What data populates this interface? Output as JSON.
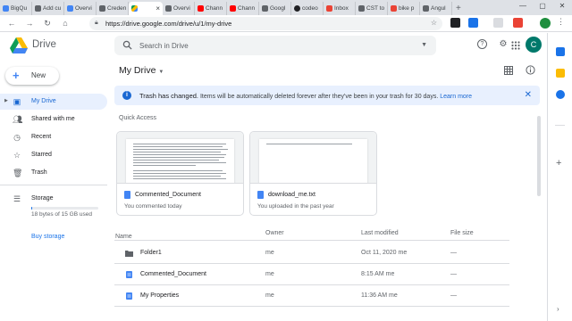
{
  "browser": {
    "tabs": [
      {
        "label": "BigQu",
        "color": "#4285f4"
      },
      {
        "label": "Add cu",
        "color": "#5f6368"
      },
      {
        "label": "Overvi",
        "color": "#4285f4"
      },
      {
        "label": "Creden",
        "color": "#5f6368"
      },
      {
        "label": "",
        "color": "#0f9d58",
        "active": true
      },
      {
        "label": "Overvi",
        "color": "#5f6368"
      },
      {
        "label": "Chann",
        "color": "#ff0000"
      },
      {
        "label": "Chann",
        "color": "#ff0000"
      },
      {
        "label": "Googl",
        "color": "#5f6368"
      },
      {
        "label": "codeo",
        "color": "#202124"
      },
      {
        "label": "Inbox",
        "color": "#ea4335"
      },
      {
        "label": "CST to",
        "color": "#5f6368"
      },
      {
        "label": "bike p",
        "color": "#ea4335"
      },
      {
        "label": "Angul",
        "color": "#5f6368"
      }
    ],
    "active_close": "×",
    "new_tab": "+",
    "url": "https://drive.google.com/drive/u/1/my-drive",
    "window_controls": [
      "—",
      "▢",
      "✕"
    ]
  },
  "header": {
    "app_name": "Drive",
    "search_placeholder": "Search in Drive",
    "profile_initial": "C"
  },
  "sidebar": {
    "new_label": "New",
    "items": [
      {
        "label": "My Drive",
        "icon": "drive-icon",
        "active": true
      },
      {
        "label": "Shared with me",
        "icon": "people-icon"
      },
      {
        "label": "Recent",
        "icon": "clock-icon"
      },
      {
        "label": "Starred",
        "icon": "star-icon"
      },
      {
        "label": "Trash",
        "icon": "trash-icon"
      }
    ],
    "storage_label": "Storage",
    "storage_used": "18 bytes of 15 GB used",
    "storage_fraction": 1.2e-09,
    "buy_storage": "Buy storage"
  },
  "main": {
    "title": "My Drive",
    "banner": {
      "bold": "Trash has changed.",
      "text": " Items will be automatically deleted forever after they've been in your trash for 30 days. ",
      "link": "Learn more"
    },
    "quick_access_label": "Quick Access",
    "cards": [
      {
        "name": "Commented_Document",
        "sub": "You commented today"
      },
      {
        "name": "download_me.txt",
        "sub": "You uploaded in the past year"
      }
    ],
    "columns": {
      "name": "Name",
      "owner": "Owner",
      "modified": "Last modified",
      "size": "File size"
    },
    "rows": [
      {
        "name": "Folder1",
        "owner": "me",
        "modified": "Oct 11, 2020 me",
        "size": "—",
        "type": "folder"
      },
      {
        "name": "Commented_Document",
        "owner": "me",
        "modified": "8:15 AM me",
        "size": "—",
        "type": "doc"
      },
      {
        "name": "My Properties",
        "owner": "me",
        "modified": "11:36 AM me",
        "size": "—",
        "type": "doc"
      }
    ]
  }
}
